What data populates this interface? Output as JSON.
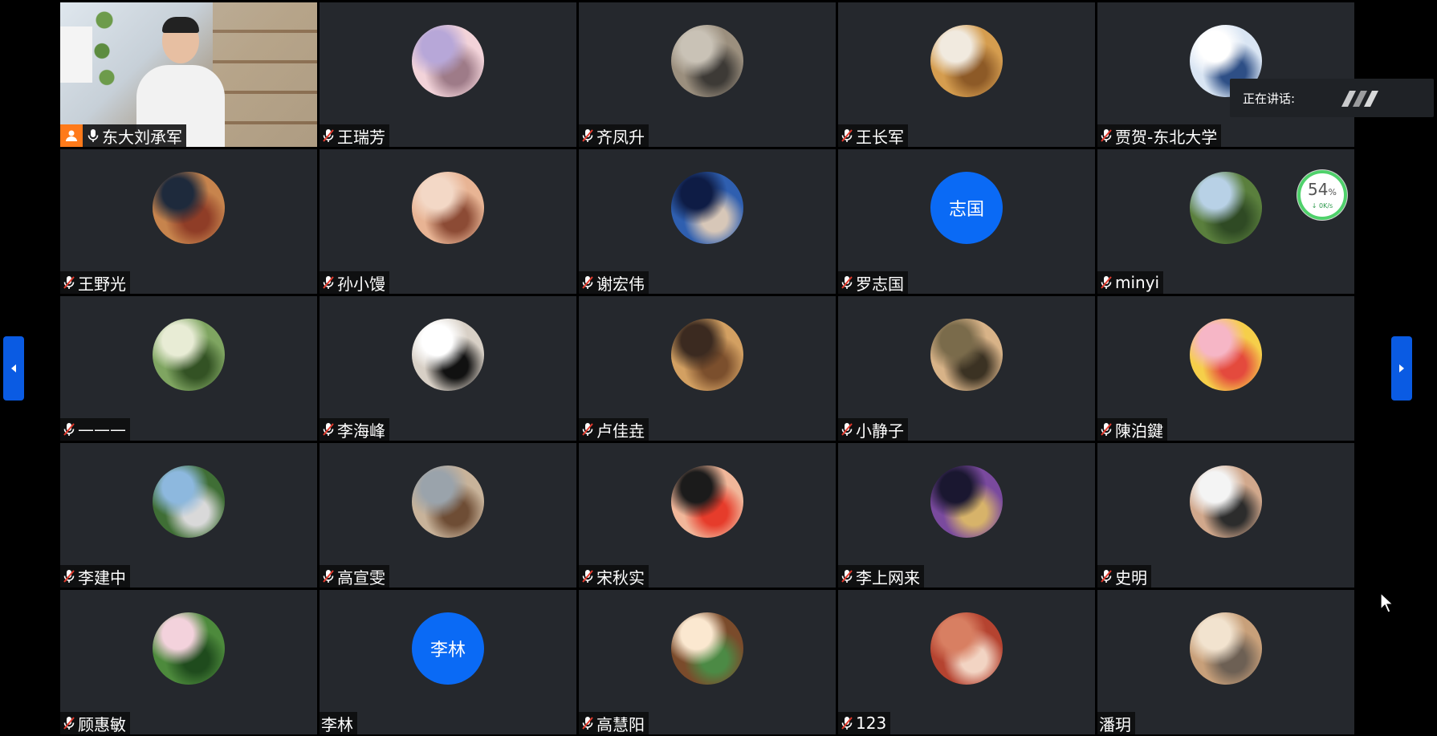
{
  "speaking": {
    "label": "正在讲话:"
  },
  "network": {
    "percent": "54",
    "unit": "%",
    "speed": "0K/s"
  },
  "participants": [
    {
      "name": "东大刘承军",
      "video": true,
      "host": true
    },
    {
      "name": "王瑞芳",
      "avatar": "photo",
      "colors": [
        "#b7a7d8",
        "#f2d3d9",
        "#9e7b88"
      ]
    },
    {
      "name": "齐凤升",
      "avatar": "photo",
      "colors": [
        "#c9c2b6",
        "#9b8f7e",
        "#3d3a36"
      ]
    },
    {
      "name": "王长军",
      "avatar": "photo",
      "colors": [
        "#f1eadf",
        "#d59d4f",
        "#8d5a27"
      ]
    },
    {
      "name": "贾贺-东北大学",
      "avatar": "photo",
      "colors": [
        "#ffffff",
        "#d9e5f3",
        "#2e4f86"
      ]
    },
    {
      "name": "王野光",
      "avatar": "photo",
      "colors": [
        "#1e2a3c",
        "#c7844d",
        "#8f3d27"
      ]
    },
    {
      "name": "孙小馒",
      "avatar": "photo",
      "colors": [
        "#f3d8c6",
        "#e8b494",
        "#8c4b35"
      ]
    },
    {
      "name": "谢宏伟",
      "avatar": "photo",
      "colors": [
        "#0e1c45",
        "#2f5fb0",
        "#d7c7b8"
      ]
    },
    {
      "name": "罗志国",
      "avatar": "text",
      "text": "志国"
    },
    {
      "name": "minyi",
      "avatar": "photo",
      "colors": [
        "#b8d1e6",
        "#5a7f3d",
        "#2f4a24"
      ]
    },
    {
      "name": "———",
      "avatar": "photo",
      "colors": [
        "#e8ecd5",
        "#7fa561",
        "#335224"
      ]
    },
    {
      "name": "李海峰",
      "avatar": "photo",
      "colors": [
        "#ffffff",
        "#d8d0c6",
        "#111111"
      ]
    },
    {
      "name": "卢佳垚",
      "avatar": "photo",
      "colors": [
        "#3b2a20",
        "#d3a062",
        "#7b4f2d"
      ]
    },
    {
      "name": "小静子",
      "avatar": "photo",
      "colors": [
        "#7a6b4b",
        "#d8b388",
        "#3b3223"
      ]
    },
    {
      "name": "陳泊鍵",
      "avatar": "photo",
      "colors": [
        "#f6b6c6",
        "#f6cf4a",
        "#e44a3d"
      ]
    },
    {
      "name": "李建中",
      "avatar": "photo",
      "colors": [
        "#8db8de",
        "#3f6e35",
        "#d9d9d9"
      ]
    },
    {
      "name": "高宣雯",
      "avatar": "photo",
      "colors": [
        "#9aa3ab",
        "#c8b39a",
        "#6e4d35"
      ]
    },
    {
      "name": "宋秋实",
      "avatar": "photo",
      "colors": [
        "#1b1b1b",
        "#f1b79a",
        "#e63c2b"
      ]
    },
    {
      "name": "李上网来",
      "avatar": "photo",
      "colors": [
        "#1a1730",
        "#7a4a9e",
        "#d7b36a"
      ]
    },
    {
      "name": "史明",
      "avatar": "photo",
      "colors": [
        "#f4f4f4",
        "#d1a88c",
        "#2c2c2c"
      ]
    },
    {
      "name": "顾惠敏",
      "avatar": "photo",
      "colors": [
        "#f3d2dc",
        "#4d8a3c",
        "#1f4b1d"
      ]
    },
    {
      "name": "李林",
      "avatar": "text",
      "text": "李林",
      "noMic": true
    },
    {
      "name": "高慧阳",
      "avatar": "photo",
      "colors": [
        "#fbe8d0",
        "#7a4b2b",
        "#4c8a45"
      ]
    },
    {
      "name": "123",
      "avatar": "photo",
      "colors": [
        "#d87f62",
        "#b54330",
        "#f2d4c3"
      ]
    },
    {
      "name": "潘玥",
      "avatar": "photo",
      "colors": [
        "#f2e3cf",
        "#c8a07a",
        "#6d6054"
      ],
      "noMic": true
    }
  ]
}
